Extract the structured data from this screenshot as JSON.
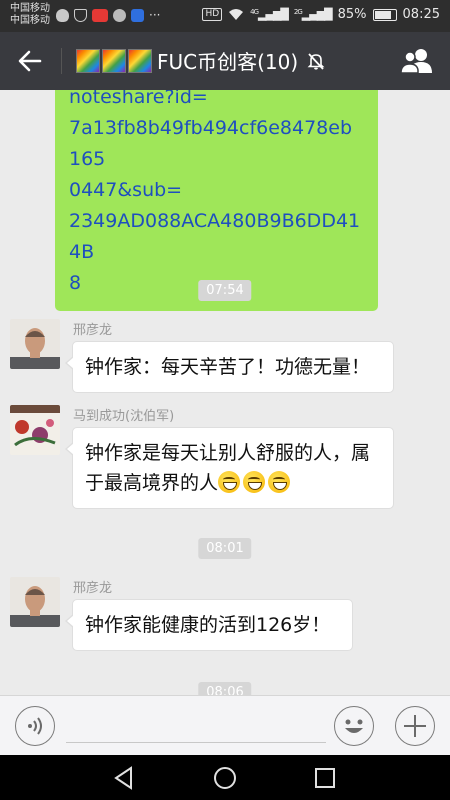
{
  "status_bar": {
    "carrier_line1": "中国移动",
    "carrier_line2": "中国移动",
    "network_badge": "HD",
    "signal1": "4G",
    "signal2": "2G",
    "battery_percent": "85%",
    "battery_level": 0.85,
    "time": "08:25",
    "more_glyph": "···"
  },
  "header": {
    "title": "FUC币创客(10)",
    "title_icons": [
      "rainbow-image-icon",
      "rainbow-image-icon",
      "rainbow-image-icon"
    ],
    "back_icon": "back-arrow-icon",
    "mute_icon": "mute-bell-icon",
    "members_icon": "group-members-icon",
    "bg_color": "#393a3f"
  },
  "chat": {
    "shared_link_text": "noteshare?id=7a13fb8b49fb494cf6e8478eb1650447&sub=2349AD088ACA480B9B6DD414B8",
    "link_lines": [
      "noteshare?id=",
      "7a13fb8b49fb494cf6e8478eb165",
      "0447&sub=",
      "2349AD088ACA480B9B6DD414B",
      "8"
    ],
    "timestamps": [
      "07:54",
      "08:01",
      "08:06"
    ],
    "messages": [
      {
        "sender": "邢彦龙",
        "text": "钟作家：每天辛苦了！功德无量！"
      },
      {
        "sender": "马到成功(沈伯军)",
        "text_line1": "钟作家是每天让别人舒服的人，属",
        "text_line2": "于最高境界的人",
        "emoji_count": 3,
        "emoji_icon": "grin-emoji-icon"
      },
      {
        "sender": "邢彦龙",
        "text": "钟作家能健康的活到126岁！"
      }
    ],
    "sent_bubble_color": "#9fe659"
  },
  "input_bar": {
    "voice_icon": "voice-icon",
    "emoji_icon": "smiley-icon",
    "plus_icon": "plus-icon"
  },
  "nav_bar": {
    "back_icon": "nav-back-icon",
    "home_icon": "nav-home-icon",
    "recents_icon": "nav-recents-icon"
  }
}
